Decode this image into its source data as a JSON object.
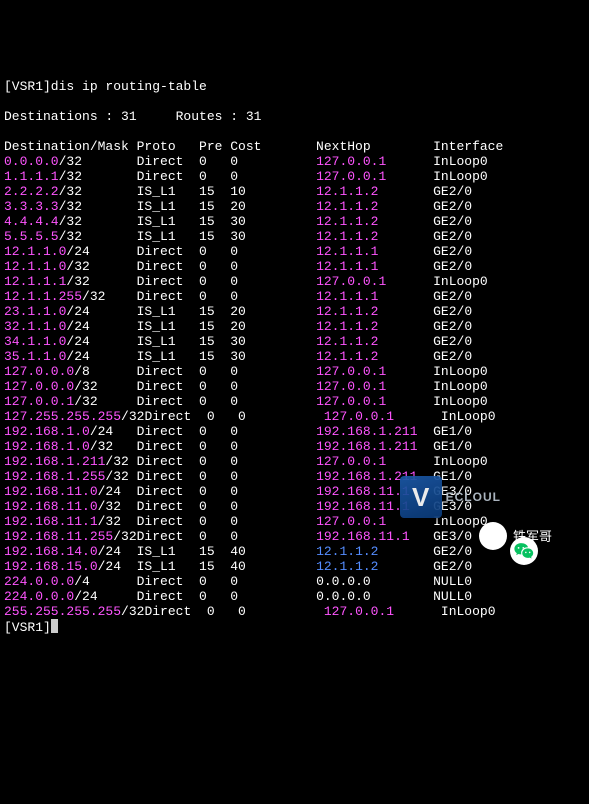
{
  "prompt_prefix": "[VSR1]",
  "command": "dis ip routing-table",
  "summary": {
    "dest_label": "Destinations : ",
    "dest_count": "31",
    "routes_label": "Routes : ",
    "routes_count": "31"
  },
  "headers": {
    "dest": "Destination/Mask",
    "proto": "Proto",
    "pre": "Pre",
    "cost": "Cost",
    "nexthop": "NextHop",
    "intf": "Interface"
  },
  "rows": [
    {
      "ip": "0.0.0.0",
      "mask": "/32",
      "proto": "Direct",
      "pre": "0",
      "cost": "0",
      "nh": "127.0.0.1",
      "intf": "InLoop0",
      "nhClass": "pink"
    },
    {
      "ip": "1.1.1.1",
      "mask": "/32",
      "proto": "Direct",
      "pre": "0",
      "cost": "0",
      "nh": "127.0.0.1",
      "intf": "InLoop0",
      "nhClass": "pink"
    },
    {
      "ip": "2.2.2.2",
      "mask": "/32",
      "proto": "IS_L1",
      "pre": "15",
      "cost": "10",
      "nh": "12.1.1.2",
      "intf": "GE2/0",
      "nhClass": "pink"
    },
    {
      "ip": "3.3.3.3",
      "mask": "/32",
      "proto": "IS_L1",
      "pre": "15",
      "cost": "20",
      "nh": "12.1.1.2",
      "intf": "GE2/0",
      "nhClass": "pink"
    },
    {
      "ip": "4.4.4.4",
      "mask": "/32",
      "proto": "IS_L1",
      "pre": "15",
      "cost": "30",
      "nh": "12.1.1.2",
      "intf": "GE2/0",
      "nhClass": "pink"
    },
    {
      "ip": "5.5.5.5",
      "mask": "/32",
      "proto": "IS_L1",
      "pre": "15",
      "cost": "30",
      "nh": "12.1.1.2",
      "intf": "GE2/0",
      "nhClass": "pink"
    },
    {
      "ip": "12.1.1.0",
      "mask": "/24",
      "proto": "Direct",
      "pre": "0",
      "cost": "0",
      "nh": "12.1.1.1",
      "intf": "GE2/0",
      "nhClass": "pink"
    },
    {
      "ip": "12.1.1.0",
      "mask": "/32",
      "proto": "Direct",
      "pre": "0",
      "cost": "0",
      "nh": "12.1.1.1",
      "intf": "GE2/0",
      "nhClass": "pink"
    },
    {
      "ip": "12.1.1.1",
      "mask": "/32",
      "proto": "Direct",
      "pre": "0",
      "cost": "0",
      "nh": "127.0.0.1",
      "intf": "InLoop0",
      "nhClass": "pink"
    },
    {
      "ip": "12.1.1.255",
      "mask": "/32",
      "proto": "Direct",
      "pre": "0",
      "cost": "0",
      "nh": "12.1.1.1",
      "intf": "GE2/0",
      "nhClass": "pink"
    },
    {
      "ip": "23.1.1.0",
      "mask": "/24",
      "proto": "IS_L1",
      "pre": "15",
      "cost": "20",
      "nh": "12.1.1.2",
      "intf": "GE2/0",
      "nhClass": "pink"
    },
    {
      "ip": "32.1.1.0",
      "mask": "/24",
      "proto": "IS_L1",
      "pre": "15",
      "cost": "20",
      "nh": "12.1.1.2",
      "intf": "GE2/0",
      "nhClass": "pink"
    },
    {
      "ip": "34.1.1.0",
      "mask": "/24",
      "proto": "IS_L1",
      "pre": "15",
      "cost": "30",
      "nh": "12.1.1.2",
      "intf": "GE2/0",
      "nhClass": "pink"
    },
    {
      "ip": "35.1.1.0",
      "mask": "/24",
      "proto": "IS_L1",
      "pre": "15",
      "cost": "30",
      "nh": "12.1.1.2",
      "intf": "GE2/0",
      "nhClass": "pink"
    },
    {
      "ip": "127.0.0.0",
      "mask": "/8",
      "proto": "Direct",
      "pre": "0",
      "cost": "0",
      "nh": "127.0.0.1",
      "intf": "InLoop0",
      "nhClass": "pink"
    },
    {
      "ip": "127.0.0.0",
      "mask": "/32",
      "proto": "Direct",
      "pre": "0",
      "cost": "0",
      "nh": "127.0.0.1",
      "intf": "InLoop0",
      "nhClass": "pink"
    },
    {
      "ip": "127.0.0.1",
      "mask": "/32",
      "proto": "Direct",
      "pre": "0",
      "cost": "0",
      "nh": "127.0.0.1",
      "intf": "InLoop0",
      "nhClass": "pink"
    },
    {
      "ip": "127.255.255.255",
      "mask": "/32",
      "proto": "Direct",
      "pre": "0",
      "cost": "0",
      "nh": "127.0.0.1",
      "intf": "InLoop0",
      "nhClass": "pink"
    },
    {
      "ip": "192.168.1.0",
      "mask": "/24",
      "proto": "Direct",
      "pre": "0",
      "cost": "0",
      "nh": "192.168.1.211",
      "intf": "GE1/0",
      "nhClass": "pink"
    },
    {
      "ip": "192.168.1.0",
      "mask": "/32",
      "proto": "Direct",
      "pre": "0",
      "cost": "0",
      "nh": "192.168.1.211",
      "intf": "GE1/0",
      "nhClass": "pink"
    },
    {
      "ip": "192.168.1.211",
      "mask": "/32",
      "proto": "Direct",
      "pre": "0",
      "cost": "0",
      "nh": "127.0.0.1",
      "intf": "InLoop0",
      "nhClass": "pink"
    },
    {
      "ip": "192.168.1.255",
      "mask": "/32",
      "proto": "Direct",
      "pre": "0",
      "cost": "0",
      "nh": "192.168.1.211",
      "intf": "GE1/0",
      "nhClass": "pink"
    },
    {
      "ip": "192.168.11.0",
      "mask": "/24",
      "proto": "Direct",
      "pre": "0",
      "cost": "0",
      "nh": "192.168.11.1",
      "intf": "GE3/0",
      "nhClass": "pink"
    },
    {
      "ip": "192.168.11.0",
      "mask": "/32",
      "proto": "Direct",
      "pre": "0",
      "cost": "0",
      "nh": "192.168.11.1",
      "intf": "GE3/0",
      "nhClass": "pink"
    },
    {
      "ip": "192.168.11.1",
      "mask": "/32",
      "proto": "Direct",
      "pre": "0",
      "cost": "0",
      "nh": "127.0.0.1",
      "intf": "InLoop0",
      "nhClass": "pink"
    },
    {
      "ip": "192.168.11.255",
      "mask": "/32",
      "proto": "Direct",
      "pre": "0",
      "cost": "0",
      "nh": "192.168.11.1",
      "intf": "GE3/0",
      "nhClass": "pink"
    },
    {
      "ip": "192.168.14.0",
      "mask": "/24",
      "proto": "IS_L1",
      "pre": "15",
      "cost": "40",
      "nh": "12.1.1.2",
      "intf": "GE2/0",
      "nhClass": "blue"
    },
    {
      "ip": "192.168.15.0",
      "mask": "/24",
      "proto": "IS_L1",
      "pre": "15",
      "cost": "40",
      "nh": "12.1.1.2",
      "intf": "GE2/0",
      "nhClass": "blue"
    },
    {
      "ip": "224.0.0.0",
      "mask": "/4",
      "proto": "Direct",
      "pre": "0",
      "cost": "0",
      "nh": "0.0.0.0",
      "intf": "NULL0",
      "nhClass": "white"
    },
    {
      "ip": "224.0.0.0",
      "mask": "/24",
      "proto": "Direct",
      "pre": "0",
      "cost": "0",
      "nh": "0.0.0.0",
      "intf": "NULL0",
      "nhClass": "white"
    },
    {
      "ip": "255.255.255.255",
      "mask": "/32",
      "proto": "Direct",
      "pre": "0",
      "cost": "0",
      "nh": "127.0.0.1",
      "intf": "InLoop0",
      "nhClass": "pink"
    }
  ],
  "final_prompt": "[VSR1]",
  "watermark": {
    "letter": "V",
    "text": "ECLOUL"
  },
  "wechat_name": "铁军哥",
  "cols": {
    "destmask": 17,
    "proto": 8,
    "pre": 4,
    "cost": 11,
    "nh": 15,
    "intf": 8
  }
}
